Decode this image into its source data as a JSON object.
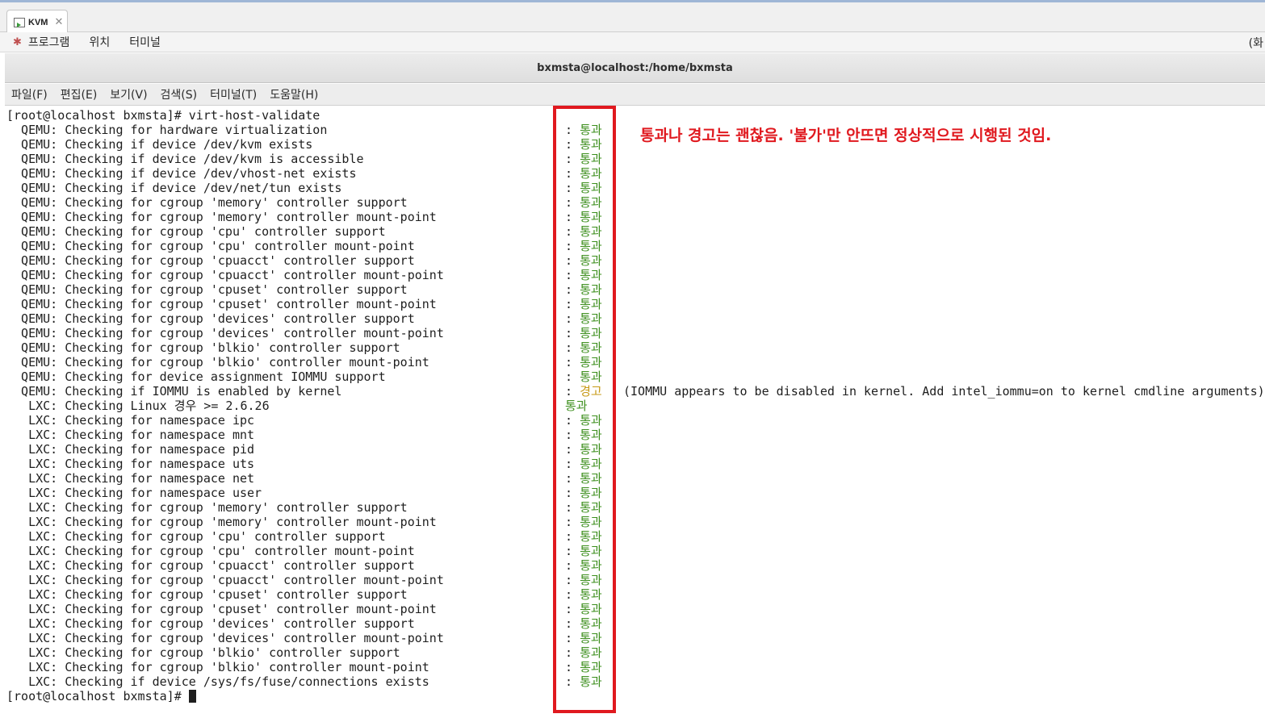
{
  "tab": {
    "label": "KVM",
    "close": "✕"
  },
  "gnome_menu": {
    "items": [
      "프로그램",
      "위치",
      "터미널"
    ],
    "right_text": "(화"
  },
  "window": {
    "title": "bxmsta@localhost:/home/bxmsta"
  },
  "terminal_menu": {
    "items": [
      "파일(F)",
      "편집(E)",
      "보기(V)",
      "검색(S)",
      "터미널(T)",
      "도움말(H)"
    ]
  },
  "terminal": {
    "command_line": "[root@localhost bxmsta]# virt-host-validate",
    "final_prompt": "[root@localhost bxmsta]# ",
    "rows": [
      {
        "text": "  QEMU: Checking for hardware virtualization",
        "status": "통과",
        "kind": "pass"
      },
      {
        "text": "  QEMU: Checking if device /dev/kvm exists",
        "status": "통과",
        "kind": "pass"
      },
      {
        "text": "  QEMU: Checking if device /dev/kvm is accessible",
        "status": "통과",
        "kind": "pass"
      },
      {
        "text": "  QEMU: Checking if device /dev/vhost-net exists",
        "status": "통과",
        "kind": "pass"
      },
      {
        "text": "  QEMU: Checking if device /dev/net/tun exists",
        "status": "통과",
        "kind": "pass"
      },
      {
        "text": "  QEMU: Checking for cgroup 'memory' controller support",
        "status": "통과",
        "kind": "pass"
      },
      {
        "text": "  QEMU: Checking for cgroup 'memory' controller mount-point",
        "status": "통과",
        "kind": "pass"
      },
      {
        "text": "  QEMU: Checking for cgroup 'cpu' controller support",
        "status": "통과",
        "kind": "pass"
      },
      {
        "text": "  QEMU: Checking for cgroup 'cpu' controller mount-point",
        "status": "통과",
        "kind": "pass"
      },
      {
        "text": "  QEMU: Checking for cgroup 'cpuacct' controller support",
        "status": "통과",
        "kind": "pass"
      },
      {
        "text": "  QEMU: Checking for cgroup 'cpuacct' controller mount-point",
        "status": "통과",
        "kind": "pass"
      },
      {
        "text": "  QEMU: Checking for cgroup 'cpuset' controller support",
        "status": "통과",
        "kind": "pass"
      },
      {
        "text": "  QEMU: Checking for cgroup 'cpuset' controller mount-point",
        "status": "통과",
        "kind": "pass"
      },
      {
        "text": "  QEMU: Checking for cgroup 'devices' controller support",
        "status": "통과",
        "kind": "pass"
      },
      {
        "text": "  QEMU: Checking for cgroup 'devices' controller mount-point",
        "status": "통과",
        "kind": "pass"
      },
      {
        "text": "  QEMU: Checking for cgroup 'blkio' controller support",
        "status": "통과",
        "kind": "pass"
      },
      {
        "text": "  QEMU: Checking for cgroup 'blkio' controller mount-point",
        "status": "통과",
        "kind": "pass"
      },
      {
        "text": "  QEMU: Checking for device assignment IOMMU support",
        "status": "통과",
        "kind": "pass"
      },
      {
        "text": "  QEMU: Checking if IOMMU is enabled by kernel",
        "status": "경고",
        "kind": "warn",
        "detail": "(IOMMU appears to be disabled in kernel. Add intel_iommu=on to kernel cmdline arguments)"
      },
      {
        "text": "   LXC: Checking Linux 경우 >= 2.6.26",
        "status": "통과",
        "kind": "pass",
        "no_colon": true
      },
      {
        "text": "   LXC: Checking for namespace ipc",
        "status": "통과",
        "kind": "pass"
      },
      {
        "text": "   LXC: Checking for namespace mnt",
        "status": "통과",
        "kind": "pass"
      },
      {
        "text": "   LXC: Checking for namespace pid",
        "status": "통과",
        "kind": "pass"
      },
      {
        "text": "   LXC: Checking for namespace uts",
        "status": "통과",
        "kind": "pass"
      },
      {
        "text": "   LXC: Checking for namespace net",
        "status": "통과",
        "kind": "pass"
      },
      {
        "text": "   LXC: Checking for namespace user",
        "status": "통과",
        "kind": "pass"
      },
      {
        "text": "   LXC: Checking for cgroup 'memory' controller support",
        "status": "통과",
        "kind": "pass"
      },
      {
        "text": "   LXC: Checking for cgroup 'memory' controller mount-point",
        "status": "통과",
        "kind": "pass"
      },
      {
        "text": "   LXC: Checking for cgroup 'cpu' controller support",
        "status": "통과",
        "kind": "pass"
      },
      {
        "text": "   LXC: Checking for cgroup 'cpu' controller mount-point",
        "status": "통과",
        "kind": "pass"
      },
      {
        "text": "   LXC: Checking for cgroup 'cpuacct' controller support",
        "status": "통과",
        "kind": "pass"
      },
      {
        "text": "   LXC: Checking for cgroup 'cpuacct' controller mount-point",
        "status": "통과",
        "kind": "pass"
      },
      {
        "text": "   LXC: Checking for cgroup 'cpuset' controller support",
        "status": "통과",
        "kind": "pass"
      },
      {
        "text": "   LXC: Checking for cgroup 'cpuset' controller mount-point",
        "status": "통과",
        "kind": "pass"
      },
      {
        "text": "   LXC: Checking for cgroup 'devices' controller support",
        "status": "통과",
        "kind": "pass"
      },
      {
        "text": "   LXC: Checking for cgroup 'devices' controller mount-point",
        "status": "통과",
        "kind": "pass"
      },
      {
        "text": "   LXC: Checking for cgroup 'blkio' controller support",
        "status": "통과",
        "kind": "pass"
      },
      {
        "text": "   LXC: Checking for cgroup 'blkio' controller mount-point",
        "status": "통과",
        "kind": "pass"
      },
      {
        "text": "   LXC: Checking if device /sys/fs/fuse/connections exists",
        "status": "통과",
        "kind": "pass"
      }
    ]
  },
  "annotation": {
    "text": "통과나 경고는 괜찮음. '불가'만 안뜨면 정상적으로 시행된 것임."
  },
  "colors": {
    "pass": "#3d8f1e",
    "warn": "#c79a16",
    "annotation": "#e0191f"
  }
}
